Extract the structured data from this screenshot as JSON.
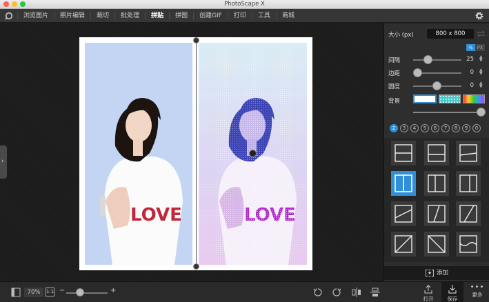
{
  "window": {
    "title": "PhotoScape X"
  },
  "menu": {
    "items": [
      "浏览图片",
      "照片编辑",
      "裁切",
      "批处理",
      "拼贴",
      "拼图",
      "创建GIF",
      "打印",
      "工具",
      "商城"
    ],
    "active_index": 4
  },
  "zoom": {
    "value": "70%",
    "one_to_one": "1:1",
    "minus": "−",
    "plus": "+",
    "level": 0.3
  },
  "bottom_buttons": {
    "open": "打开",
    "save": "保存",
    "more": "更多"
  },
  "panel": {
    "size_label": "大小 (px)",
    "size_value": "800 x 800",
    "unit_percent": "%",
    "unit_px": "PX",
    "spacing_label": "间隔",
    "spacing_value": "25",
    "margin_label": "边距",
    "margin_value": "0",
    "round_label": "圆度",
    "round_value": "0",
    "background_label": "背景",
    "photo_counts": [
      "2",
      "3",
      "4",
      "5",
      "6",
      "7",
      "8",
      "9",
      "0"
    ],
    "selected_count": "2",
    "add_label": "添加"
  },
  "colors": {
    "accent": "#2f8fd8",
    "bg": "#1e1e1e",
    "panel": "#2e2e2e"
  },
  "photo_text": {
    "left": "LOVE",
    "right": "LOVE"
  }
}
